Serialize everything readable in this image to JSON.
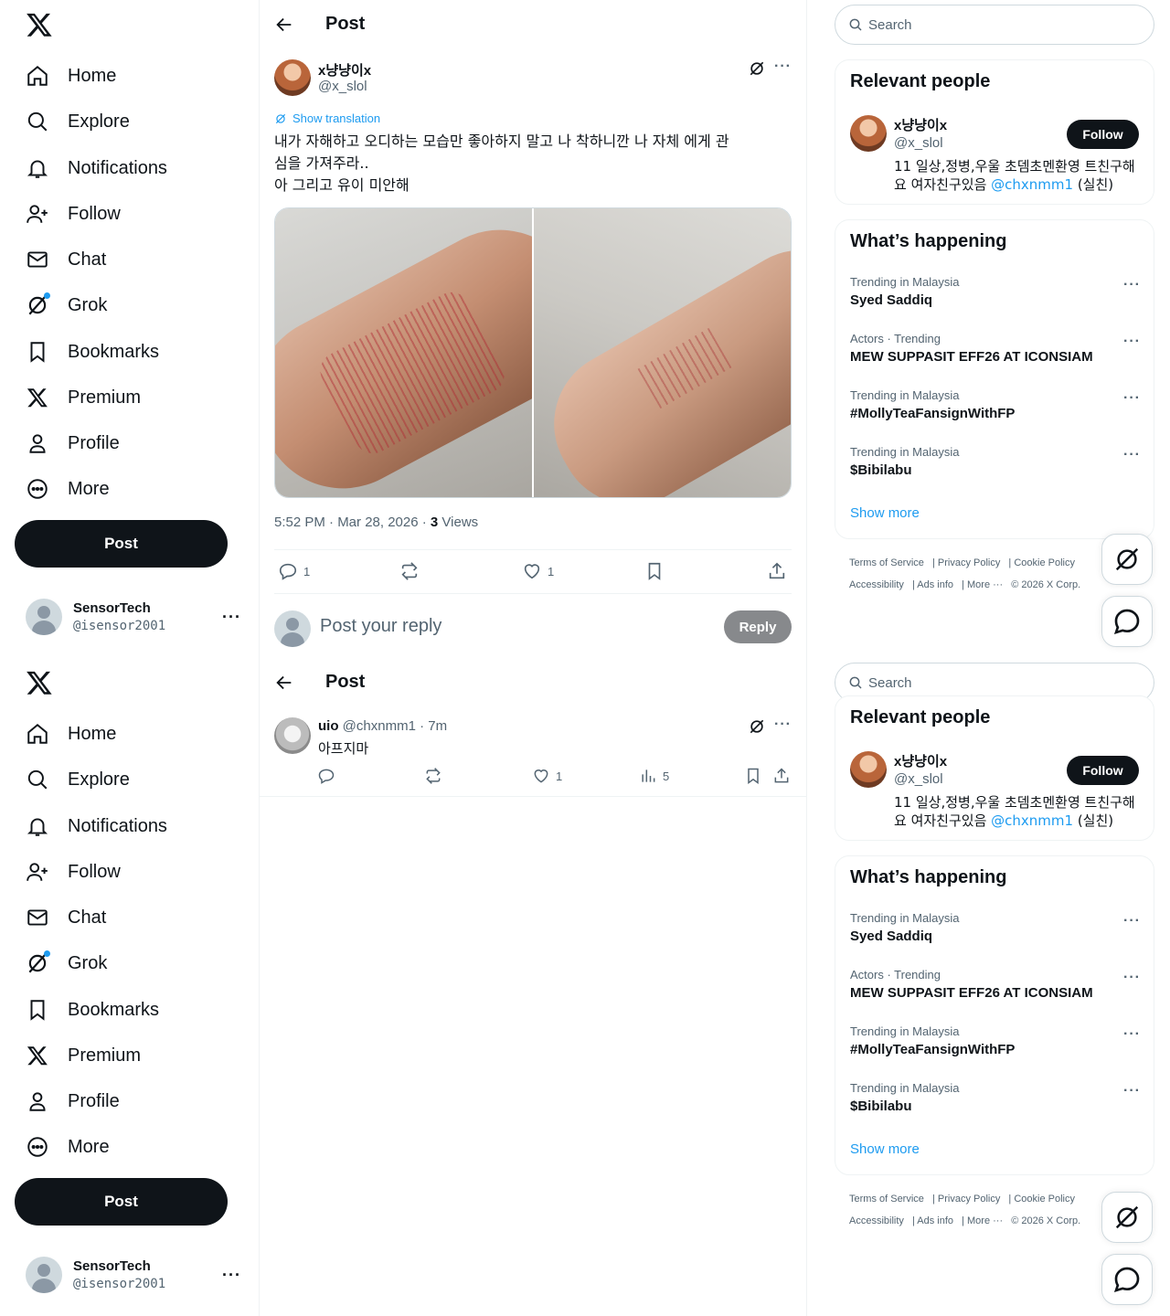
{
  "nav": {
    "items": [
      {
        "label": "Home",
        "icon": "home-icon"
      },
      {
        "label": "Explore",
        "icon": "search-icon"
      },
      {
        "label": "Notifications",
        "icon": "bell-icon"
      },
      {
        "label": "Follow",
        "icon": "person-add-icon"
      },
      {
        "label": "Chat",
        "icon": "mail-icon"
      },
      {
        "label": "Grok",
        "icon": "grok-icon"
      },
      {
        "label": "Bookmarks",
        "icon": "bookmark-icon"
      },
      {
        "label": "Premium",
        "icon": "x-icon"
      },
      {
        "label": "Profile",
        "icon": "person-icon"
      },
      {
        "label": "More",
        "icon": "more-circle-icon"
      }
    ],
    "post_button": "Post",
    "account": {
      "name": "SensorTech",
      "handle": "@isensor2001"
    }
  },
  "header": {
    "title": "Post"
  },
  "post": {
    "author_name": "x냥냥이x",
    "author_handle": "@x_slol",
    "show_translation": "Show translation",
    "text_line1": "내가 자해하고 오디하는 모습만 좋아하지 말고 나 착하니깐 나 자체 에게 관",
    "text_line2": "심을 가져주라..",
    "text_line3": "아 그리고 유이 미안해",
    "timestamp": "5:52 PM · Mar 28, 2026 · ",
    "views_count": "3",
    "views_label": " Views",
    "reply_count": "1",
    "like_count": "1"
  },
  "reply_composer": {
    "placeholder": "Post your reply",
    "button": "Reply"
  },
  "reply": {
    "name": "uio",
    "handle_time": " @chxnmm1 · 7m",
    "text": "아프지마",
    "like_count": "1",
    "view_count": "5"
  },
  "sidebar": {
    "search_placeholder": "Search",
    "relevant_title": "Relevant people",
    "person": {
      "name": "x냥냥이x",
      "handle": "@x_slol",
      "follow": "Follow",
      "bio_part1": "11 일상,정병,우울 초뎀초멘환영 트친구해요 여자친구있음 ",
      "bio_mention": "@chxnmm1",
      "bio_part2": " (실친)"
    },
    "happening_title": "What’s happening",
    "trends": [
      {
        "context": "Trending in Malaysia",
        "name": "Syed Saddiq"
      },
      {
        "context": "Actors · Trending",
        "name": "MEW SUPPASIT EFF26 AT ICONSIAM"
      },
      {
        "context": "Trending in Malaysia",
        "name": "#MollyTeaFansignWithFP"
      },
      {
        "context": "Trending in Malaysia",
        "name": "$Bibilabu"
      }
    ],
    "show_more": "Show more",
    "footer": {
      "terms": "Terms of Service",
      "privacy": "Privacy Policy",
      "cookie": "Cookie Policy",
      "accessibility": "Accessibility",
      "ads": "Ads info",
      "more": "More ···",
      "copyright": "© 2026 X Corp."
    }
  },
  "colors": {
    "accent": "#1d9bf0",
    "text": "#0f1419",
    "muted": "#536471",
    "border": "#eff3f4"
  }
}
